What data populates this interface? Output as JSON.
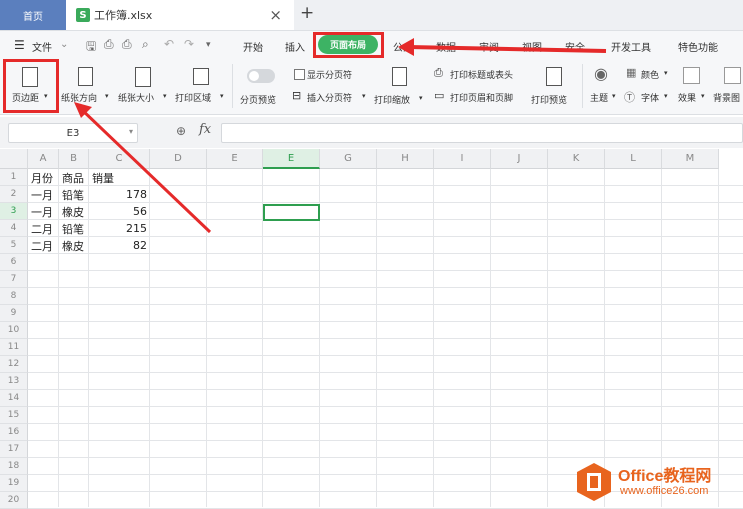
{
  "tabs": {
    "home": "首页",
    "file_icon": "S",
    "file_name": "工作簿.xlsx",
    "close": "×",
    "new": "+"
  },
  "menu": {
    "file": "文件",
    "items": [
      "开始",
      "插入",
      "页面布局",
      "公式",
      "数据",
      "审阅",
      "视图",
      "安全",
      "开发工具",
      "特色功能"
    ],
    "active_index": 2
  },
  "ribbon": {
    "margins": "页边距",
    "orientation": "纸张方向",
    "size": "纸张大小",
    "print_area": "打印区域",
    "page_break_preview": "分页预览",
    "show_page_breaks": "显示分页符",
    "insert_page_break": "插入分页符",
    "print_scale": "打印缩放",
    "print_titles": "打印标题或表头",
    "print_header_footer": "打印页眉和页脚",
    "print_preview": "打印预览",
    "theme": "主题",
    "colors": "颜色",
    "fonts": "字体",
    "effects": "效果",
    "background": "背景图"
  },
  "formula_bar": {
    "cell_ref": "E3",
    "fx": "fx",
    "formula": ""
  },
  "columns": [
    "A",
    "B",
    "C",
    "D",
    "E",
    "F",
    "G",
    "H",
    "I",
    "J",
    "K",
    "L",
    "M"
  ],
  "rows": [
    "1",
    "2",
    "3",
    "4",
    "5",
    "6",
    "7",
    "8",
    "9",
    "10",
    "11",
    "12",
    "13",
    "14",
    "15",
    "16",
    "17",
    "18",
    "19",
    "20"
  ],
  "sheet": {
    "headers": [
      "月份",
      "商品",
      "销量"
    ],
    "data": [
      [
        "一月",
        "铅笔",
        "178"
      ],
      [
        "一月",
        "橡皮",
        "56"
      ],
      [
        "二月",
        "铅笔",
        "215"
      ],
      [
        "二月",
        "橡皮",
        "82"
      ]
    ]
  },
  "selected_cell": "E3",
  "colors": {
    "accent": "#3db364",
    "annotation": "#e52a2a",
    "home_tab": "#5b7fbe",
    "watermark": "#e8641e"
  },
  "watermark": {
    "brand": "Office教程网",
    "url": "www.office26.com"
  }
}
